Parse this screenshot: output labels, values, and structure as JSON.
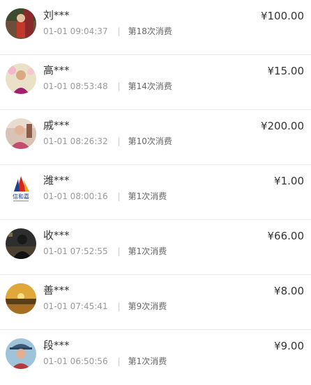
{
  "orders": [
    {
      "name": "刘***",
      "time": "01-01 09:04:37",
      "count": "第18次消费",
      "amount": "¥100.00",
      "avatar": "avatar-photo-woman-red"
    },
    {
      "name": "高***",
      "time": "01-01 08:53:48",
      "count": "第14次消费",
      "amount": "¥15.00",
      "avatar": "avatar-photo-woman-flowers"
    },
    {
      "name": "戚***",
      "time": "01-01 08:26:32",
      "count": "第10次消费",
      "amount": "¥200.00",
      "avatar": "avatar-photo-woman-pink"
    },
    {
      "name": "潍***",
      "time": "01-01 08:00:16",
      "count": "第1次消费",
      "amount": "¥1.00",
      "avatar": "avatar-logo-sail"
    },
    {
      "name": "收***",
      "time": "01-01 07:52:55",
      "count": "第1次消费",
      "amount": "¥66.00",
      "avatar": "avatar-photo-dark"
    },
    {
      "name": "善***",
      "time": "01-01 07:45:41",
      "count": "第9次消费",
      "amount": "¥8.00",
      "avatar": "avatar-photo-sunset-lake"
    },
    {
      "name": "段***",
      "time": "01-01 06:50:56",
      "count": "第1次消费",
      "amount": "¥9.00",
      "avatar": "avatar-photo-person-hat"
    }
  ],
  "separator": "|",
  "logo_text": "信和嘉"
}
